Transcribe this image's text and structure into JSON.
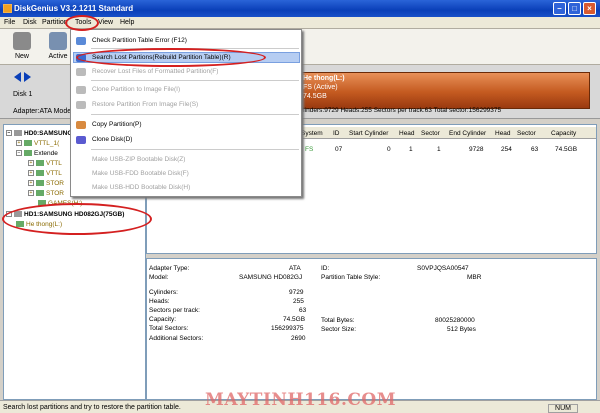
{
  "window": {
    "title": "DiskGenius V3.2.1211 Standard"
  },
  "menubar": [
    "File",
    "Disk",
    "Partition",
    "Tools",
    "View",
    "Help"
  ],
  "toolbar": {
    "new_label": "New",
    "active_label": "Active"
  },
  "disk_bar": {
    "disk_label": "Disk 1",
    "adapter": "Adapter:ATA  Mode",
    "partition_name": "He thong(L:)",
    "partition_fs": "FS (Active)",
    "partition_size": "74.5GB",
    "info": "ylinders:9729  Heads:255  Sectors per track:63  Total sector:156299375"
  },
  "tree": {
    "hd0_label": "HD0:SAMSUNG",
    "vttl1": "VTTL_1(",
    "extended": "Extende",
    "vttl2": "VTTL",
    "vttl3": "VTTL",
    "stor1": "STOR",
    "stor2": "STOR",
    "games": "GAMES(H:)",
    "hd1_label": "HD1:SAMSUNG HD082GJ(75GB)",
    "hethong": "He thong(L:)"
  },
  "part_table": {
    "headers": [
      "System",
      "ID",
      "Start Cylinder",
      "Head",
      "Sector",
      "End Cylinder",
      "Head",
      "Sector",
      "Capacity"
    ],
    "row": [
      "FS",
      "07",
      "0",
      "1",
      "1",
      "9728",
      "254",
      "63",
      "74.5GB"
    ]
  },
  "disk_info": {
    "adapter_type_label": "Adapter Type:",
    "adapter_type": "ATA",
    "id_label": "ID:",
    "id": "S0VPJQSA00547",
    "model_label": "Model:",
    "model": "SAMSUNG HD082GJ",
    "pts_label": "Partition Table Style:",
    "pts": "MBR",
    "cylinders_label": "Cylinders:",
    "cylinders": "9729",
    "heads_label": "Heads:",
    "heads": "255",
    "spt_label": "Sectors per track:",
    "spt": "63",
    "capacity_label": "Capacity:",
    "capacity": "74.5GB",
    "total_bytes_label": "Total Bytes:",
    "total_bytes": "80025280000",
    "total_sectors_label": "Total Sectors:",
    "total_sectors": "156299375",
    "sector_size_label": "Sector Size:",
    "sector_size": "512 Bytes",
    "additional_label": "Additional Sectors:",
    "additional": "2690"
  },
  "tools_menu": {
    "check": "Check Partition Table Error (F12)",
    "search": "Search Lost Partions(Rebuild Partition Table)(R)",
    "recover": "Recover Lost Files of Formatted Partition(F)",
    "clone_to_image": "Clone Partition to Image File(I)",
    "restore_from_image": "Restore Partition From Image File(S)",
    "copy_partition": "Copy Partition(P)",
    "clone_disk": "Clone Disk(D)",
    "usb_zip": "Make USB-ZIP Bootable Disk(Z)",
    "usb_fdd": "Make USB-FDD Bootable Disk(F)",
    "usb_hdd": "Make USB-HDD Bootable Disk(H)"
  },
  "status": {
    "text": "Search lost partitions and try to restore the partition table.",
    "num": "NUM"
  },
  "watermark": {
    "number": "116",
    "site": "MAYTINH116.COM"
  }
}
